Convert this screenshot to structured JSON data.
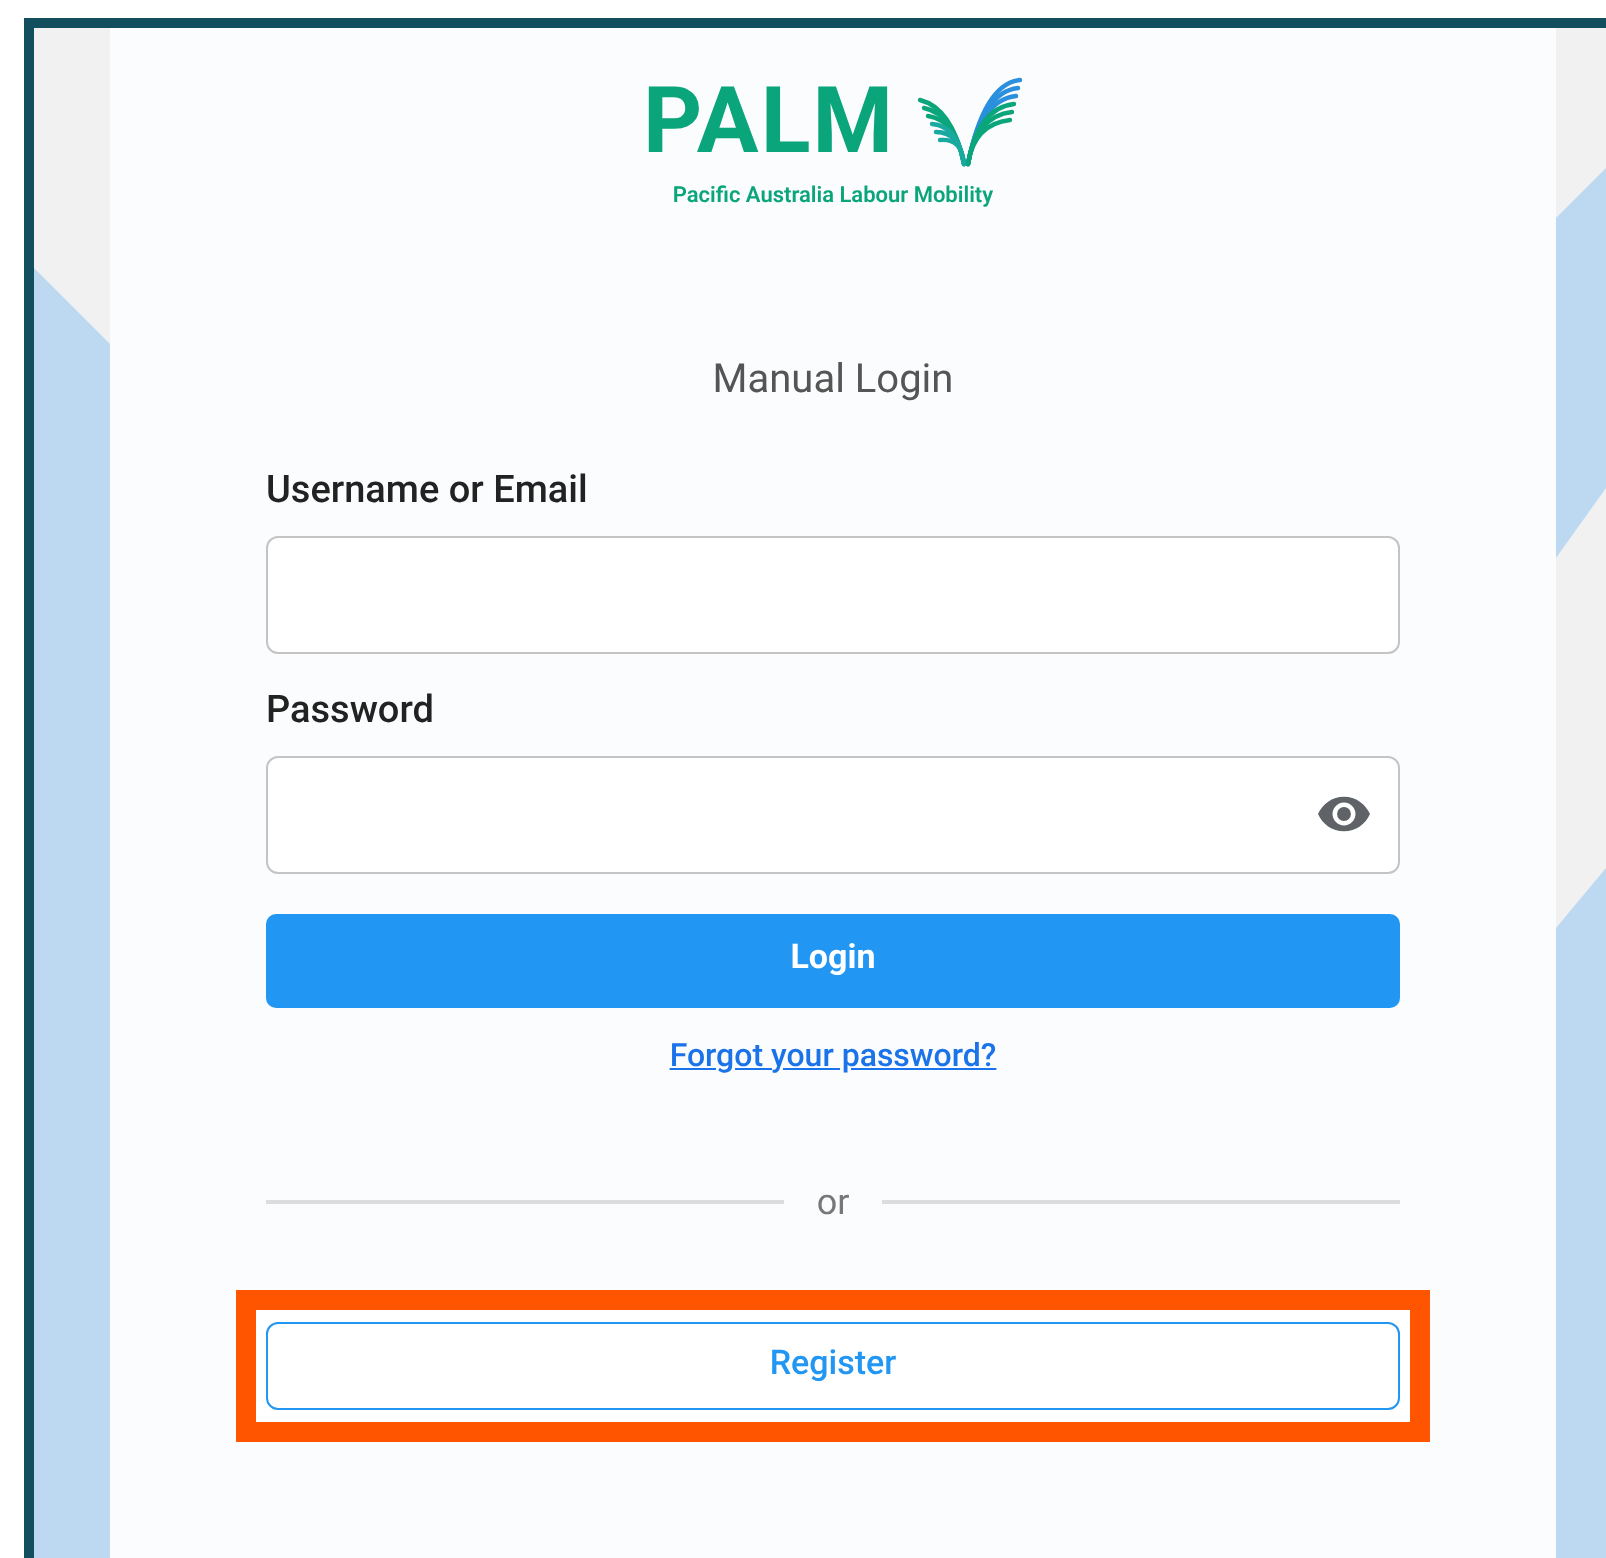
{
  "logo": {
    "wordmark": "PALM",
    "tagline": "Pacific Australia Labour Mobility"
  },
  "title": "Manual Login",
  "fields": [
    {
      "label": "Username or Email",
      "kind": "text"
    },
    {
      "label": "Password",
      "kind": "password"
    }
  ],
  "login_button": "Login",
  "forgot_link": "Forgot your password?",
  "divider": "or",
  "register_button": {
    "label": "Register",
    "highlighted": true
  }
}
